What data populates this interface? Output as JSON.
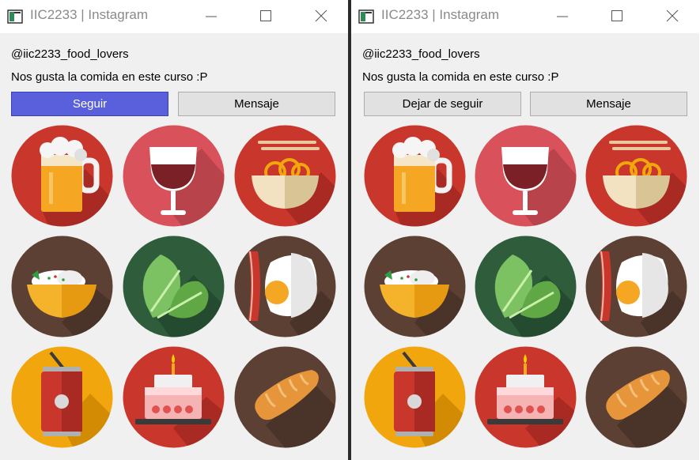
{
  "windows": [
    {
      "title": "IIC2233 | Instagram",
      "username": "@iic2233_food_lovers",
      "bio": "Nos gusta la comida en este curso :P",
      "follow_label": "Seguir",
      "message_label": "Mensaje",
      "follow_color": "#5a5fdb"
    },
    {
      "title": "IIC2233 | Instagram",
      "username": "@iic2233_food_lovers",
      "bio": "Nos gusta la comida en este curso :P",
      "follow_label": "Dejar de seguir",
      "message_label": "Mensaje",
      "follow_color": "#e1e1e1"
    }
  ],
  "grid_icons": [
    "beer-mug-icon",
    "wine-glass-icon",
    "noodle-bowl-icon",
    "rice-bowl-icon",
    "lettuce-icon",
    "bacon-egg-icon",
    "soda-can-icon",
    "birthday-cake-icon",
    "bread-loaf-icon"
  ],
  "colors": {
    "red_circle": "#c9372c",
    "pink_circle": "#d9515a",
    "brown_circle": "#5c4033",
    "green_circle": "#2f5d3c",
    "orange_circle": "#f2a60d"
  }
}
